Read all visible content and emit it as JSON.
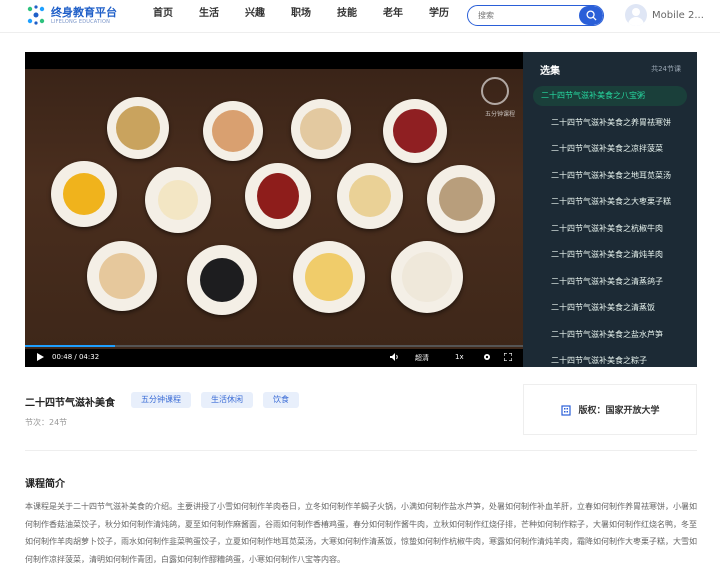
{
  "header": {
    "logo_title": "终身教育平台",
    "logo_sub": "LIFELONG EDUCATION",
    "nav": [
      "首页",
      "生活",
      "兴趣",
      "职场",
      "技能",
      "老年",
      "学历"
    ],
    "search_placeholder": "搜索",
    "username": "Mobile 2..."
  },
  "video": {
    "time": "00:48 / 04:32",
    "quality": "超清",
    "speed": "1x",
    "watermark": "五分钟课程",
    "progress": 0.18
  },
  "playlist": {
    "title": "选集",
    "count": "共24节课",
    "items": [
      "二十四节气滋补美食之八宝粥",
      "二十四节气滋补美食之养胃祛寒饼",
      "二十四节气滋补美食之凉拌菠菜",
      "二十四节气滋补美食之地耳苋菜汤",
      "二十四节气滋补美食之大枣栗子糕",
      "二十四节气滋补美食之杭椒牛肉",
      "二十四节气滋补美食之清炖羊肉",
      "二十四节气滋补美食之清蒸鸽子",
      "二十四节气滋补美食之清蒸饭",
      "二十四节气滋补美食之盐水芦笋",
      "二十四节气滋补美食之粽子"
    ]
  },
  "course": {
    "title": "二十四节气滋补美食",
    "tags": [
      "五分钟课程",
      "生活休闲",
      "饮食"
    ],
    "sections": "节次：24节",
    "copyright": "版权：国家开放大学"
  },
  "intro": {
    "title": "课程简介",
    "text": "本课程是关于二十四节气滋补美食的介绍。主要讲授了小雪如何制作羊肉卷日，立冬如何制作羊蝎子火锅，小满如何制作盐水芦笋，处暑如何制作补血羊肝，立春如何制作养胃祛寒饼，小暑如何制作香菇油菜饺子，秋分如何制作清炖鸽，夏至如何制作麻酱面，谷雨如何制作香椿鸡蛋，春分如何制作酱牛肉，立秋如何制作红烧仔排，芒种如何制作粽子，大暑如何制作红烧名鸭，冬至如何制作羊肉胡萝卜饺子，雨水如何制作韭菜鸭蛋饺子，立夏如何制作地耳苋菜汤，大寒如何制作清蒸饭，惊蛰如何制作杭椒牛肉，寒露如何制作清炖羊肉，霜降如何制作大枣栗子糕，大雪如何制作凉拌菠菜，清明如何制作青团，白露如何制作醪糟鸽蛋，小寒如何制作八宝等内容。"
  },
  "colors": {
    "brand": "#2a5fd8",
    "playlist_bg": "#1c2a35",
    "active_item": "#26d9a0"
  }
}
